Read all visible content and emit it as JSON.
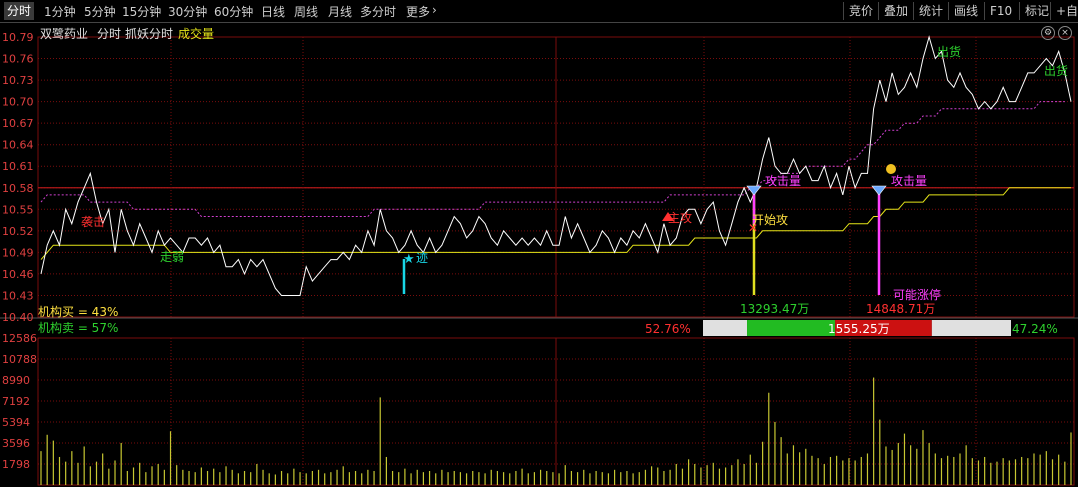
{
  "toolbar": {
    "tabs": [
      "分时",
      "1分钟",
      "5分钟",
      "15分钟",
      "30分钟",
      "60分钟",
      "日线",
      "周线",
      "月线",
      "多分时",
      "更多"
    ],
    "more_arrow": "›",
    "right_buttons": [
      "竞价",
      "叠加",
      "统计",
      "画线",
      "F10",
      "标记",
      "+自选"
    ]
  },
  "header": {
    "stock_name": "双鹭药业",
    "mode": "分时",
    "indicator": "抓妖分时",
    "volume_label": "成交量",
    "settings_icon": "gear-icon",
    "close_icon": "close-icon"
  },
  "colors": {
    "price_line": "#ffffff",
    "avg_line": "#e6e619",
    "ma_line": "#d040d0",
    "grid": "#7a0d0d",
    "axis_text": "#e04040",
    "green": "#2ed12e",
    "buy_bar": "#22bb22",
    "sell_bar": "#cc1111"
  },
  "chart_data": {
    "type": "line",
    "price_axis_ticks": [
      "10.79",
      "10.76",
      "10.73",
      "10.70",
      "10.67",
      "10.64",
      "10.61",
      "10.58",
      "10.55",
      "10.52",
      "10.49",
      "10.46",
      "10.43",
      "10.40"
    ],
    "price_ylim": [
      10.4,
      10.79
    ],
    "prev_close": 10.58,
    "volume_axis_ticks": [
      "12586",
      "10788",
      "8990",
      "7192",
      "5394",
      "3596",
      "1798"
    ],
    "volume_ylim": [
      0,
      12586
    ],
    "series": [
      {
        "values": [
          10.46,
          10.5,
          10.52,
          10.5,
          10.55,
          10.53,
          10.56,
          10.58,
          10.6,
          10.56,
          10.53,
          10.55,
          10.49,
          10.55,
          10.52,
          10.5,
          10.53,
          10.51,
          10.49,
          10.52,
          10.5,
          10.51,
          10.5,
          10.49,
          10.51,
          10.51,
          10.5,
          10.51,
          10.49,
          10.5,
          10.47,
          10.47,
          10.48,
          10.46,
          10.48,
          10.47,
          10.48,
          10.46,
          10.44,
          10.43,
          10.43,
          10.43,
          10.43,
          10.47,
          10.45,
          10.46,
          10.47,
          10.48,
          10.48,
          10.49,
          10.48,
          10.5,
          10.49,
          10.52,
          10.5,
          10.55,
          10.52,
          10.51,
          10.49,
          10.5,
          10.52,
          10.5,
          10.49,
          10.51,
          10.49,
          10.5,
          10.52,
          10.54,
          10.53,
          10.51,
          10.52,
          10.54,
          10.53,
          10.51,
          10.5,
          10.52,
          10.51,
          10.5,
          10.51,
          10.5,
          10.51,
          10.5,
          10.52,
          10.5,
          10.5,
          10.54,
          10.51,
          10.53,
          10.51,
          10.49,
          10.5,
          10.52,
          10.51,
          10.49,
          10.51,
          10.5,
          10.52,
          10.51,
          10.53,
          10.51,
          10.49,
          10.53,
          10.5,
          10.51,
          10.54,
          10.55,
          10.55,
          10.53,
          10.55,
          10.56,
          10.52,
          10.5,
          10.53,
          10.56,
          10.58,
          10.56,
          10.58,
          10.62,
          10.65,
          10.61,
          10.6,
          10.6,
          10.62,
          10.6,
          10.61,
          10.59,
          10.59,
          10.61,
          10.58,
          10.6,
          10.57,
          10.61,
          10.58,
          10.6,
          10.6,
          10.69,
          10.73,
          10.7,
          10.74,
          10.71,
          10.72,
          10.74,
          10.72,
          10.76,
          10.79,
          10.76,
          10.77,
          10.73,
          10.72,
          10.74,
          10.72,
          10.71,
          10.69,
          10.7,
          10.69,
          10.7,
          10.72,
          10.7,
          10.7,
          10.72,
          10.74,
          10.74,
          10.75,
          10.76,
          10.75,
          10.77,
          10.74,
          10.7
        ]
      },
      {
        "values": [
          10.48,
          10.49,
          10.5,
          10.5,
          10.5,
          10.5,
          10.5,
          10.5,
          10.5,
          10.5,
          10.5,
          10.5,
          10.5,
          10.5,
          10.5,
          10.5,
          10.5,
          10.5,
          10.5,
          10.5,
          10.5,
          10.49,
          10.49,
          10.49,
          10.49,
          10.49,
          10.49,
          10.49,
          10.49,
          10.49,
          10.49,
          10.49,
          10.49,
          10.49,
          10.49,
          10.49,
          10.49,
          10.49,
          10.49,
          10.49,
          10.49,
          10.49,
          10.49,
          10.49,
          10.49,
          10.49,
          10.49,
          10.49,
          10.49,
          10.49,
          10.49,
          10.49,
          10.49,
          10.49,
          10.49,
          10.49,
          10.49,
          10.49,
          10.49,
          10.49,
          10.49,
          10.49,
          10.49,
          10.49,
          10.49,
          10.49,
          10.49,
          10.49,
          10.49,
          10.49,
          10.49,
          10.49,
          10.49,
          10.49,
          10.49,
          10.49,
          10.49,
          10.49,
          10.49,
          10.49,
          10.49,
          10.49,
          10.49,
          10.49,
          10.49,
          10.49,
          10.49,
          10.49,
          10.49,
          10.49,
          10.49,
          10.49,
          10.49,
          10.49,
          10.49,
          10.49,
          10.5,
          10.5,
          10.5,
          10.5,
          10.5,
          10.5,
          10.5,
          10.5,
          10.5,
          10.5,
          10.51,
          10.51,
          10.51,
          10.51,
          10.51,
          10.51,
          10.51,
          10.51,
          10.51,
          10.51,
          10.51,
          10.52,
          10.52,
          10.52,
          10.52,
          10.52,
          10.52,
          10.52,
          10.52,
          10.52,
          10.52,
          10.52,
          10.52,
          10.52,
          10.52,
          10.53,
          10.53,
          10.53,
          10.53,
          10.54,
          10.54,
          10.55,
          10.55,
          10.55,
          10.56,
          10.56,
          10.56,
          10.56,
          10.57,
          10.57,
          10.57,
          10.57,
          10.57,
          10.57,
          10.57,
          10.57,
          10.57,
          10.57,
          10.57,
          10.57,
          10.57,
          10.58,
          10.58,
          10.58,
          10.58,
          10.58,
          10.58,
          10.58,
          10.58,
          10.58,
          10.58,
          10.58
        ]
      },
      {
        "values": [
          10.56,
          10.57,
          10.57,
          10.57,
          10.57,
          10.57,
          10.57,
          10.57,
          10.56,
          10.56,
          10.56,
          10.56,
          10.56,
          10.56,
          10.56,
          10.55,
          10.55,
          10.55,
          10.55,
          10.55,
          10.55,
          10.55,
          10.55,
          10.55,
          10.55,
          10.55,
          10.54,
          10.54,
          10.54,
          10.54,
          10.54,
          10.54,
          10.54,
          10.54,
          10.54,
          10.54,
          10.54,
          10.54,
          10.54,
          10.54,
          10.54,
          10.54,
          10.54,
          10.54,
          10.54,
          10.54,
          10.54,
          10.54,
          10.54,
          10.54,
          10.54,
          10.54,
          10.54,
          10.54,
          10.55,
          10.55,
          10.55,
          10.55,
          10.55,
          10.55,
          10.55,
          10.55,
          10.55,
          10.55,
          10.55,
          10.55,
          10.55,
          10.55,
          10.55,
          10.55,
          10.55,
          10.55,
          10.56,
          10.56,
          10.56,
          10.56,
          10.56,
          10.56,
          10.56,
          10.56,
          10.56,
          10.56,
          10.56,
          10.56,
          10.56,
          10.56,
          10.56,
          10.56,
          10.56,
          10.56,
          10.56,
          10.56,
          10.56,
          10.56,
          10.56,
          10.56,
          10.56,
          10.56,
          10.56,
          10.56,
          10.56,
          10.56,
          10.57,
          10.57,
          10.57,
          10.57,
          10.57,
          10.57,
          10.57,
          10.57,
          10.57,
          10.57,
          10.57,
          10.57,
          10.57,
          10.58,
          10.58,
          10.59,
          10.59,
          10.59,
          10.6,
          10.6,
          10.6,
          10.6,
          10.61,
          10.61,
          10.61,
          10.61,
          10.61,
          10.61,
          10.61,
          10.62,
          10.62,
          10.63,
          10.64,
          10.64,
          10.65,
          10.66,
          10.66,
          10.66,
          10.67,
          10.67,
          10.67,
          10.68,
          10.68,
          10.68,
          10.69,
          10.69,
          10.69,
          10.69,
          10.69,
          10.69,
          10.69,
          10.69,
          10.69,
          10.69,
          10.69,
          10.69,
          10.69,
          10.69,
          10.69,
          10.69,
          10.7,
          10.7,
          10.7,
          10.7,
          10.7
        ]
      }
    ],
    "volume_values": [
      2900,
      4300,
      3800,
      2400,
      2000,
      2900,
      1900,
      3300,
      1600,
      2000,
      2700,
      1400,
      2100,
      3600,
      1200,
      1500,
      1900,
      1100,
      1600,
      1800,
      1300,
      4600,
      1700,
      1300,
      1200,
      1100,
      1500,
      1200,
      1400,
      1100,
      1600,
      1300,
      1000,
      1200,
      1100,
      1800,
      1300,
      1000,
      900,
      1200,
      1000,
      1400,
      1100,
      1000,
      1200,
      1300,
      1000,
      1100,
      1300,
      1600,
      1100,
      1200,
      1000,
      1300,
      1200,
      7500,
      2400,
      1200,
      1100,
      1400,
      1000,
      1300,
      1100,
      1200,
      1000,
      1300,
      1100,
      1200,
      1100,
      1000,
      1200,
      1100,
      1000,
      1300,
      1200,
      1100,
      1000,
      1200,
      1400,
      1000,
      1100,
      1300,
      1200,
      1100,
      1000,
      1700,
      1200,
      1100,
      1300,
      1000,
      1200,
      1100,
      1000,
      1300,
      1100,
      1200,
      1000,
      1100,
      1300,
      1600,
      1500,
      1200,
      1300,
      1800,
      1400,
      2200,
      1800,
      1500,
      1700,
      1900,
      1400,
      1500,
      1700,
      2200,
      1800,
      2600,
      1900,
      3700,
      7900,
      5400,
      4100,
      2700,
      3400,
      2800,
      3100,
      2500,
      2300,
      1800,
      2400,
      2500,
      2100,
      2300,
      2100,
      2400,
      2700,
      9200,
      5600,
      3300,
      3000,
      3600,
      4400,
      3400,
      3100,
      4700,
      3600,
      2700,
      2300,
      2500,
      2400,
      2700,
      3400,
      2300,
      2100,
      2400,
      1900,
      2000,
      2300,
      2100,
      2200,
      2400,
      2300,
      2700,
      2600,
      2900,
      2200,
      2600,
      2000,
      4500
    ]
  },
  "annotations": {
    "attack_label": "袭击",
    "weak_label": "走弱",
    "ji_label": "迹",
    "main_attack_label": "主攻",
    "start_attack_label": "开始攻",
    "attack_volume_label_1": "攻击量",
    "attack_volume_label_2": "攻击量",
    "out_label_1": "出货",
    "out_label_2": "出货",
    "limit_up_label": "可能涨停",
    "value_1": "13293.47万",
    "value_2": "14848.71万"
  },
  "stats": {
    "inst_buy": "机构买 = 43%",
    "inst_sell": "机构卖 = 57%",
    "left_pct": "52.76%",
    "center_value": "1555.25万",
    "right_pct": "47.24%",
    "bar_split": {
      "gray_left": 0.143,
      "green": 0.286,
      "red": 0.314,
      "gray_right": 0.257
    }
  }
}
